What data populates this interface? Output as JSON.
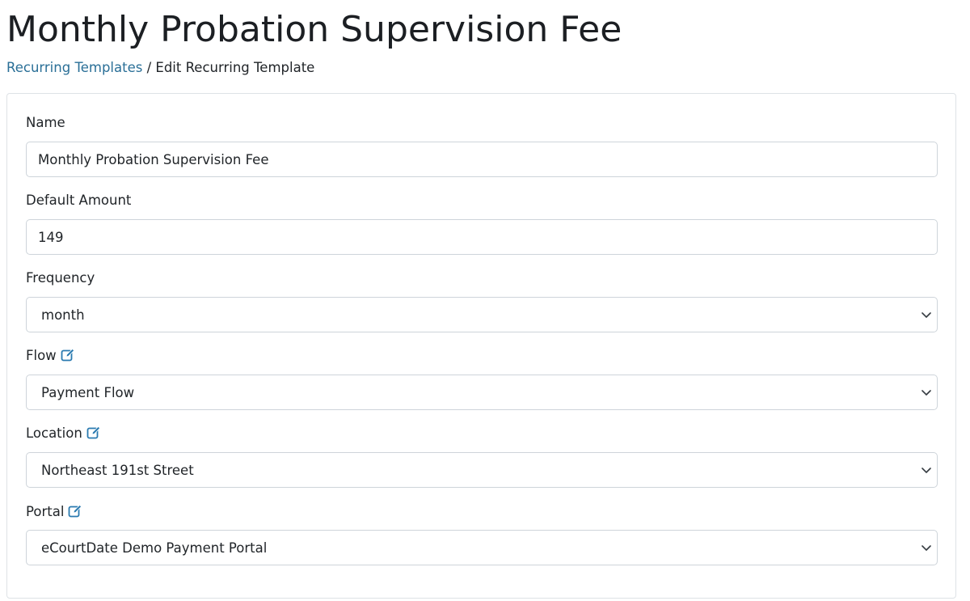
{
  "page": {
    "title": "Monthly Probation Supervision Fee"
  },
  "breadcrumb": {
    "link_label": "Recurring Templates",
    "separator": "/",
    "current": "Edit Recurring Template"
  },
  "form": {
    "name": {
      "label": "Name",
      "value": "Monthly Probation Supervision Fee"
    },
    "default_amount": {
      "label": "Default Amount",
      "value": "149"
    },
    "frequency": {
      "label": "Frequency",
      "selected": "month"
    },
    "flow": {
      "label": "Flow",
      "selected": "Payment Flow",
      "edit_icon": "edit-icon"
    },
    "location": {
      "label": "Location",
      "selected": "Northeast 191st Street",
      "edit_icon": "edit-icon"
    },
    "portal": {
      "label": "Portal",
      "selected": "eCourtDate Demo Payment Portal",
      "edit_icon": "edit-icon"
    }
  },
  "colors": {
    "link": "#2a6f97",
    "icon": "#2a7ab0",
    "border": "#ced4da",
    "card_border": "#dee2e6"
  }
}
